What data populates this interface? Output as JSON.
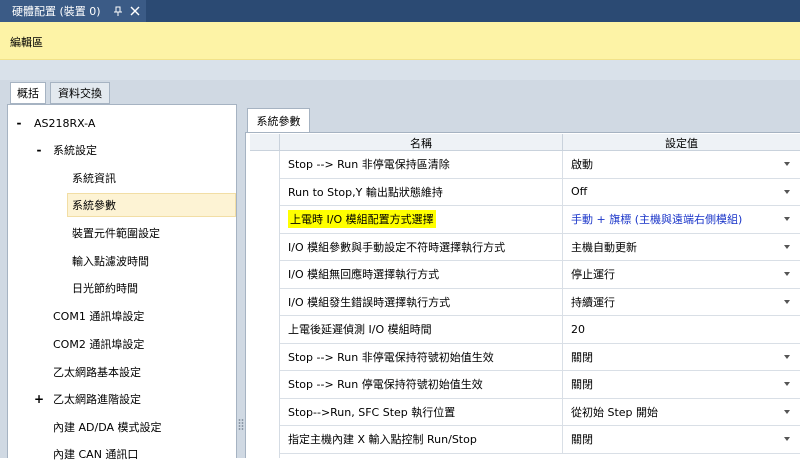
{
  "document_tab": {
    "title": "硬體配置 (裝置 0)",
    "pin_glyph": "ᵖ",
    "close_glyph": "✕"
  },
  "edit_area": {
    "label": "編輯區"
  },
  "main_tabs": [
    {
      "label": "概括"
    },
    {
      "label": "資料交換"
    }
  ],
  "tree": {
    "root": {
      "expander": "-",
      "label": "AS218RX-A"
    },
    "items": [
      {
        "expander": "-",
        "label": "系統設定"
      },
      {
        "expander": "",
        "label": "系統資訊"
      },
      {
        "expander": "",
        "label": "系統參數"
      },
      {
        "expander": "",
        "label": "裝置元件範圍設定"
      },
      {
        "expander": "",
        "label": "輸入點濾波時間"
      },
      {
        "expander": "",
        "label": "日光節約時間"
      },
      {
        "expander": "",
        "label": "COM1 通訊埠設定"
      },
      {
        "expander": "",
        "label": "COM2 通訊埠設定"
      },
      {
        "expander": "",
        "label": "乙太網路基本設定"
      },
      {
        "expander": "+",
        "label": "乙太網路進階設定"
      },
      {
        "expander": "",
        "label": "內建 AD/DA 模式設定"
      },
      {
        "expander": "",
        "label": "內建 CAN 通訊口"
      }
    ]
  },
  "sub_tab": {
    "label": "系統參數"
  },
  "grid": {
    "headers": {
      "name": "名稱",
      "value": "設定值"
    },
    "rows": [
      {
        "name": "Stop --> Run 非停電保持區清除",
        "value": "啟動"
      },
      {
        "name": "Run to Stop,Y 輸出點狀態維持",
        "value": "Off"
      },
      {
        "name": "上電時 I/O 模組配置方式選擇",
        "value": "手動 + 旗標 (主機與遠端右側模組)"
      },
      {
        "name": "I/O 模組參數與手動設定不符時選擇執行方式",
        "value": "主機自動更新"
      },
      {
        "name": "I/O 模組無回應時選擇執行方式",
        "value": "停止運行"
      },
      {
        "name": "I/O 模組發生錯誤時選擇執行方式",
        "value": "持續運行"
      },
      {
        "name": "上電後延遲偵測 I/O 模組時間",
        "value": "20"
      },
      {
        "name": "Stop --> Run 非停電保持符號初始值生效",
        "value": "關閉"
      },
      {
        "name": "Stop --> Run 停電保持符號初始值生效",
        "value": "關閉"
      },
      {
        "name": "Stop-->Run, SFC Step 執行位置",
        "value": "從初始 Step 開始"
      },
      {
        "name": "指定主機內建 X 輸入點控制 Run/Stop",
        "value": "關閉"
      }
    ]
  },
  "colors": {
    "highlight": "#ffff00",
    "value_blue": "#1a35c9",
    "edit_area_bg": "#fdf3a6",
    "doc_strip": "#2b4a73"
  }
}
